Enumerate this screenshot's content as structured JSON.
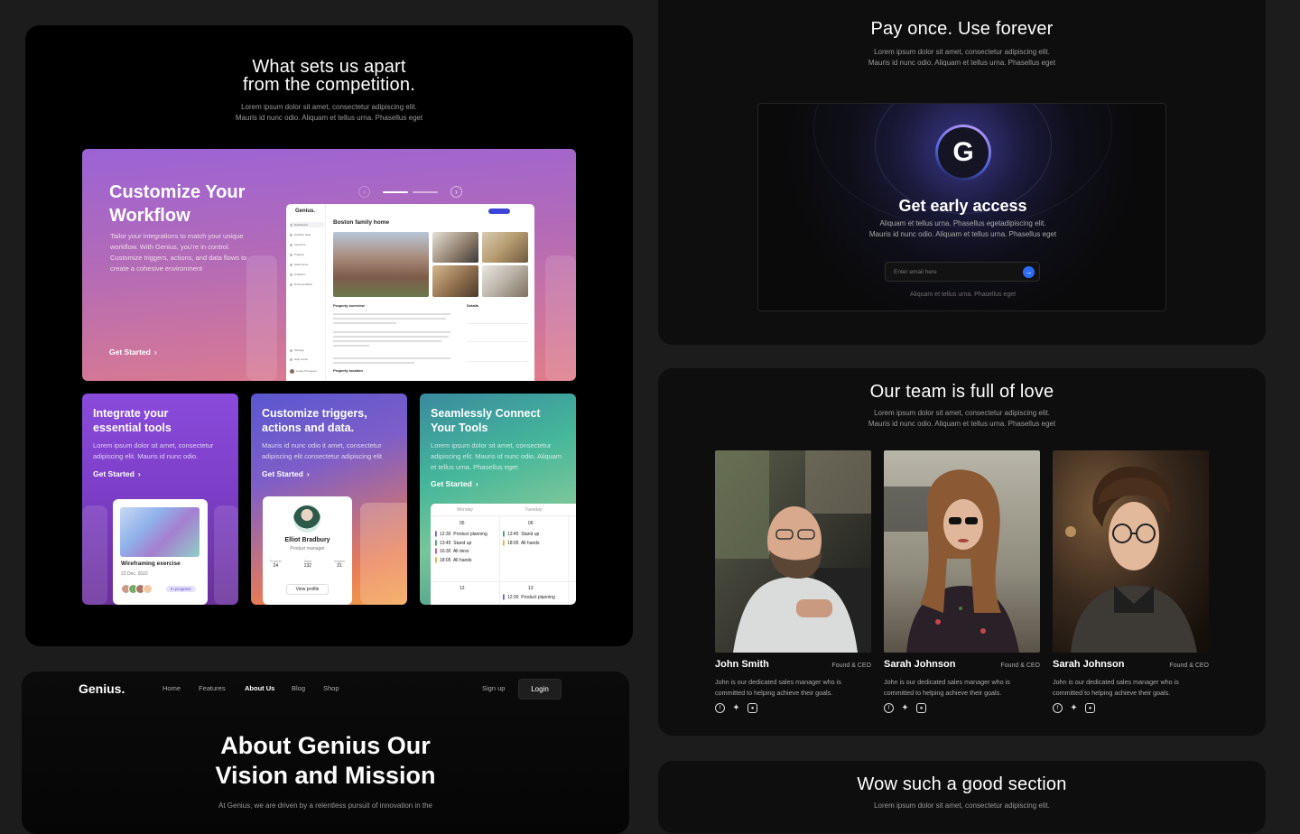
{
  "features": {
    "title_line1": "What sets us apart",
    "title_line2": "from the competition.",
    "subtitle_line1": "Lorem ipsum dolor sit amet, consectetur adipiscing elit.",
    "subtitle_line2": "Mauris id nunc odio. Aliquam et tellus urna. Phasellus eget",
    "hero": {
      "title_line1": "Customize Your",
      "title_line2": "Workflow",
      "description": "Tailor your integrations to match your unique workflow. With Genius, you're in control. Customize triggers, actions, and data flows to create a cohesive environment",
      "cta": "Get Started",
      "app": {
        "logo": "Genius.",
        "page_title": "Boston family home",
        "nav": [
          "Dashboard",
          "Portfolio stats",
          "Favorites",
          "Projects",
          "Statements",
          "Analytics",
          "Documentation"
        ],
        "nav_bottom": [
          "Settings",
          "Help center"
        ],
        "user": "Lucas Thompson",
        "overview_title": "Property overview",
        "details_title": "Details",
        "location_title": "Property location"
      }
    },
    "cards": [
      {
        "title_line1": "Integrate your",
        "title_line2": "essential tools",
        "description": "Lorem ipsum dolor sit amet, consectetur adipiscing elit. Mauris id nunc odio.",
        "cta": "Get Started",
        "mock_title": "Wireframing exercise",
        "mock_date": "23 Dec, 2022",
        "mock_badge": "In progress"
      },
      {
        "title_line1": "Customize triggers,",
        "title_line2": "actions and data.",
        "description": "Mauris id nunc odio it amet, consectetur adipiscing elit consectetur adipiscing elit",
        "cta": "Get Started",
        "profile_name": "Elliot Bradbury",
        "profile_role": "Product manager",
        "stats": [
          {
            "label": "Projects",
            "value": "24"
          },
          {
            "label": "Tasks",
            "value": "132"
          },
          {
            "label": "Insights",
            "value": "31"
          }
        ],
        "profile_button": "View profile"
      },
      {
        "title_line1": "Seamlessly Connect",
        "title_line2": "Your Tools",
        "description": "Lorem ipsum dolor sit amet, consectetur adipiscing elit. Mauris id nunc odio. Aliquam et tellus urna. Phasellus eget",
        "cta": "Get Started",
        "calendar": {
          "days": [
            "Monday",
            "Tuesday"
          ],
          "dates": [
            "05",
            "06",
            "12",
            "13"
          ],
          "mon_events": [
            {
              "time": "12:30",
              "label": "Product planning"
            },
            {
              "time": "13:45",
              "label": "Stand up"
            },
            {
              "time": "16:30",
              "label": "All devs"
            },
            {
              "time": "18:05",
              "label": "All hands"
            }
          ],
          "tue_events": [
            {
              "time": "13:45",
              "label": "Stand up"
            },
            {
              "time": "18:05",
              "label": "All hands"
            }
          ],
          "bottom_event": {
            "time": "12:30",
            "label": "Product planning"
          }
        }
      }
    ]
  },
  "about": {
    "brand": "Genius.",
    "nav": [
      "Home",
      "Features",
      "About Us",
      "Blog",
      "Shop"
    ],
    "active_nav": "About Us",
    "signup": "Sign up",
    "login": "Login",
    "title_line1": "About Genius Our",
    "title_line2": "Vision and Mission",
    "subtitle": "At Genius, we are driven by a relentless pursuit of innovation in the"
  },
  "pricing": {
    "title": "Pay once. Use forever",
    "subtitle_line1": "Lorem ipsum dolor sit amet, consectetur adipiscing elit.",
    "subtitle_line2": "Mauris id nunc odio. Aliquam et tellus urna. Phasellus eget",
    "logo_letter": "G",
    "access_title": "Get early access",
    "access_sub_line1": "Aliquam et tellus urna. Phasellus egetadipiscing elit.",
    "access_sub_line2": "Mauris id nunc odio. Aliquam et tellus urna. Phasellus eget",
    "email_placeholder": "Enter email here",
    "footnote": "Aliquam et tellus urna. Phasellus eget"
  },
  "team": {
    "title": "Our team is full of love",
    "subtitle_line1": "Lorem ipsum dolor sit amet, consectetur adipiscing elit.",
    "subtitle_line2": "Mauris id nunc odio. Aliquam et tellus urna. Phasellus eget",
    "members": [
      {
        "name": "John Smith",
        "role": "Found & CEO",
        "bio": "John is our dedicated sales manager who is committed to helping achieve their goals."
      },
      {
        "name": "Sarah Johnson",
        "role": "Found & CEO",
        "bio": "John is our dedicated sales manager who is committed to helping achieve their goals."
      },
      {
        "name": "Sarah Johnson",
        "role": "Found & CEO",
        "bio": "John is our dedicated sales manager who is committed to helping achieve their goals."
      }
    ],
    "social_icons": [
      "facebook-icon",
      "twitter-icon",
      "instagram-icon"
    ]
  },
  "wow": {
    "title": "Wow such a good section",
    "subtitle": "Lorem ipsum dolor sit amet, consectetur adipiscing elit."
  }
}
